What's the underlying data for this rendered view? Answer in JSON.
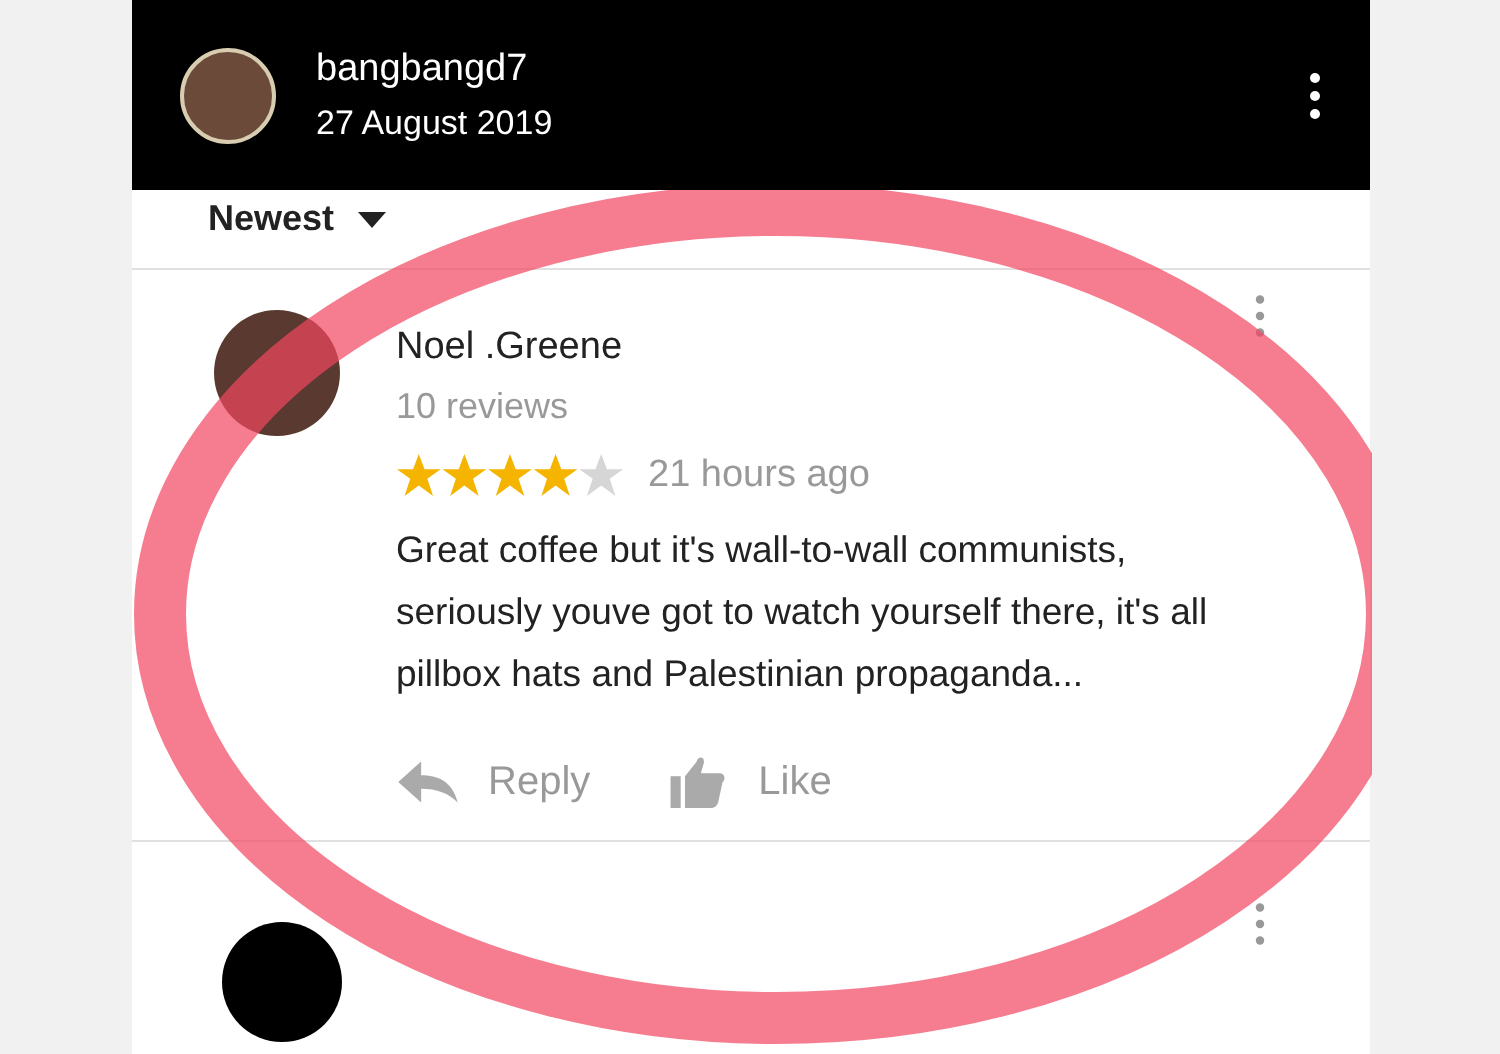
{
  "header": {
    "username": "bangbangd7",
    "date": "27 August 2019"
  },
  "sort": {
    "label": "Newest"
  },
  "reviews": [
    {
      "author": "Noel .Greene",
      "review_count": "10 reviews",
      "stars": 4,
      "time": "21 hours ago",
      "text": "Great coffee but it's wall-to-wall communists, seriously youve got to watch yourself there, it's all pillbox hats and Palestinian propaganda...",
      "actions": [
        "Reply",
        "Like"
      ]
    }
  ]
}
